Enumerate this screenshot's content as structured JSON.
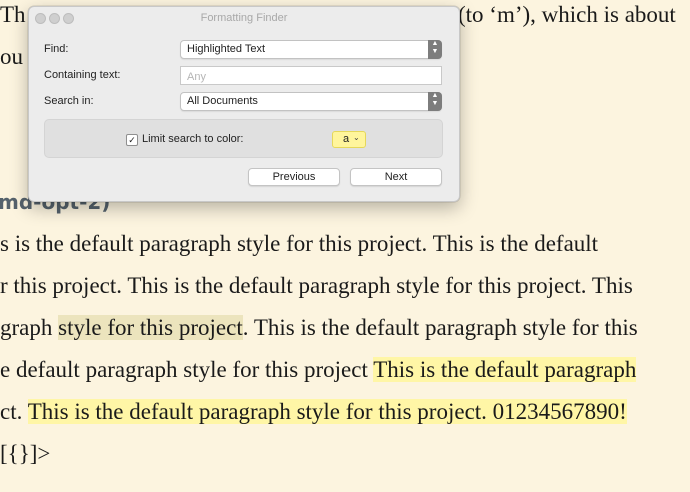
{
  "document": {
    "top_line_left": "Th",
    "top_line_right": "(to ‘m’), which is about",
    "line2_fragment": "ou",
    "heading": "md-opt-2)",
    "para1": "s is the default paragraph style for this project. This is the default",
    "para2": "r this project. This is the default paragraph style for this project. This",
    "para3_pre": "graph ",
    "para3_hl": "style for this project",
    "para3_post": ". This is the default paragraph style for this",
    "para4_pre": "e default paragraph style for this project ",
    "para4_hl": "This is the default paragraph",
    "para5_pre": "ct. ",
    "para5_hl": "This is the default paragraph style for this project. 01234567890!",
    "para6": "[{}]>"
  },
  "panel": {
    "title": "Formatting Finder",
    "find_label": "Find:",
    "find_value": "Highlighted Text",
    "containing_label": "Containing text:",
    "containing_placeholder": "Any",
    "search_in_label": "Search in:",
    "search_in_value": "All Documents",
    "limit_label": "Limit search to color:",
    "limit_checked": true,
    "color_swatch_label": "a",
    "color_swatch_color": "#fff59c",
    "previous_label": "Previous",
    "next_label": "Next"
  }
}
